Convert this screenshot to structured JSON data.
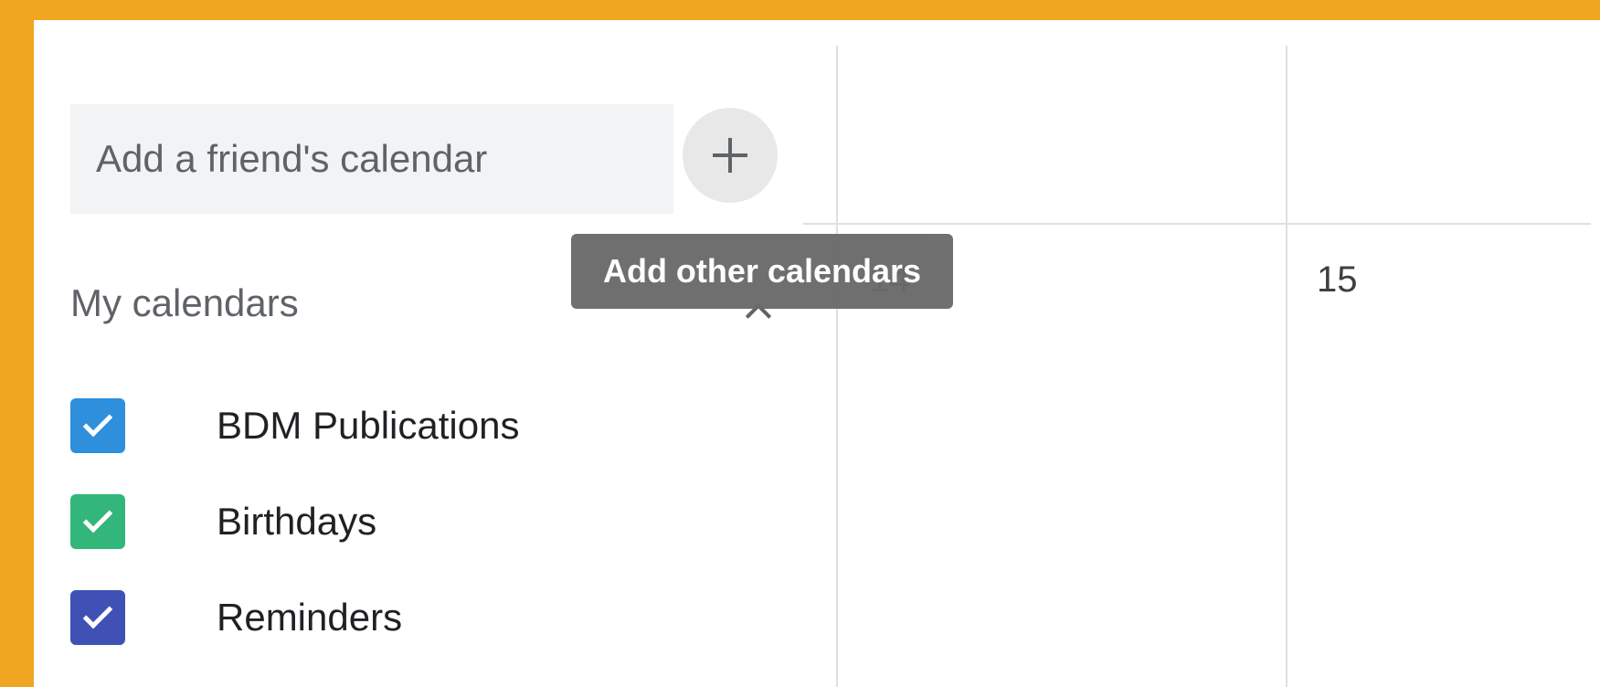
{
  "sidebar": {
    "friend_calendar_placeholder": "Add a friend's calendar",
    "add_button_icon": "plus-icon",
    "section": {
      "title": "My calendars",
      "toggle_icon": "chevron-up-icon"
    },
    "calendars": [
      {
        "label": "BDM Publications",
        "color": "#2e8fdc",
        "checked": true
      },
      {
        "label": "Birthdays",
        "color": "#33b679",
        "checked": true
      },
      {
        "label": "Reminders",
        "color": "#3f51b5",
        "checked": true
      }
    ]
  },
  "tooltip": {
    "text": "Add other calendars"
  },
  "grid": {
    "days": [
      "14",
      "15"
    ]
  },
  "colors": {
    "frame": "#f0a620",
    "panel": "#ffffff",
    "input_background": "#f1f3f4",
    "tooltip_background": "#6a6a6a",
    "gridline": "#e0e0e0"
  }
}
